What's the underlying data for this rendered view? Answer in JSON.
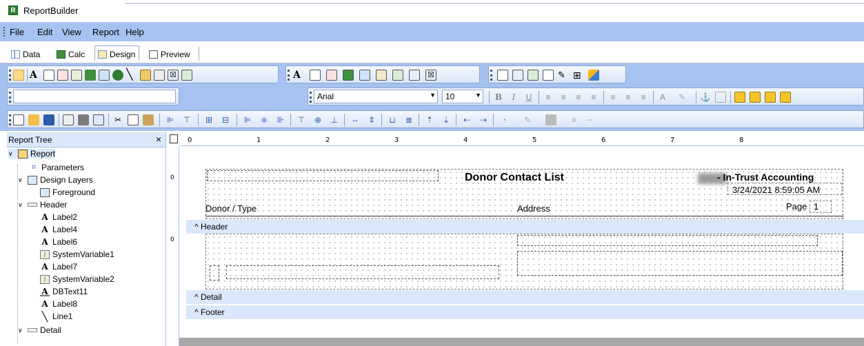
{
  "app": {
    "title": "ReportBuilder",
    "icon": "report-builder-logo-icon"
  },
  "menu": {
    "items": [
      "File",
      "Edit",
      "View",
      "Report",
      "Help"
    ]
  },
  "tabs": [
    {
      "label": "Data",
      "icon": "data-tab-icon",
      "active": false
    },
    {
      "label": "Calc",
      "icon": "calc-tab-icon",
      "active": false
    },
    {
      "label": "Design",
      "icon": "design-tab-icon",
      "active": true
    },
    {
      "label": "Preview",
      "icon": "preview-tab-icon",
      "active": false
    }
  ],
  "format": {
    "font": "Arial",
    "size": "10"
  },
  "tree": {
    "title": "Report Tree",
    "close": "×",
    "nodes": {
      "report": "Report",
      "parameters": "Parameters",
      "design_layers": "Design Layers",
      "foreground": "Foreground",
      "header": "Header",
      "label2": "Label2",
      "label4": "Label4",
      "label6": "Label6",
      "sysvar1": "SystemVariable1",
      "label7": "Label7",
      "sysvar2": "SystemVariable2",
      "dbtext11": "DBText11",
      "label8": "Label8",
      "line1": "Line1",
      "detail": "Detail"
    }
  },
  "ruler": {
    "marks": [
      "0",
      "1",
      "2",
      "3",
      "4",
      "5",
      "6",
      "7",
      "8"
    ],
    "vmark": "0"
  },
  "report": {
    "title": "Donor Contact List",
    "org": "- In-Trust Accounting",
    "datetime": "3/24/2021 8:59:05 AM",
    "page_label": "Page",
    "page_num": "1",
    "col_donor": "Donor / Type",
    "col_address": "Address"
  },
  "bands": {
    "header": "^ Header",
    "detail": "^ Detail",
    "footer": "^ Footer"
  }
}
